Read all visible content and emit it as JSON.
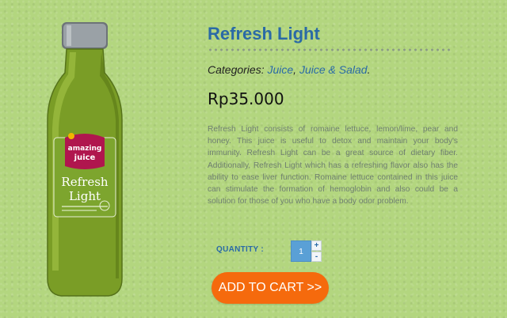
{
  "product": {
    "title": "Refresh Light",
    "categories_label": "Categories:",
    "categories": [
      "Juice",
      "Juice & Salad"
    ],
    "category_separator": ",",
    "category_end": ".",
    "price": "Rp35.000",
    "description": "Refresh Light consists of romaine lettuce, lemon/lime, pear and honey. This juice is useful to detox and maintain your body's immunity. Refresh Light can be a great source of dietary fiber. Additionally, Refresh Light which has a refreshing flavor also has the ability to ease liver function. Romaine lettuce contained in this juice can stimulate the formation of hemoglobin and also could be a solution for those of you who have a body odor problem.",
    "image_label": {
      "brand_line1": "amazing",
      "brand_line2": "juice",
      "name_line1": "Refresh",
      "name_line2": "Light"
    }
  },
  "quantity": {
    "label": "QUANTITY :",
    "value": "1",
    "increment": "+",
    "decrement": "-"
  },
  "cart": {
    "button_label": "ADD TO CART >>"
  },
  "colors": {
    "background": "#b3d67f",
    "accent": "#2a6aa6",
    "button": "#f56a0d"
  }
}
